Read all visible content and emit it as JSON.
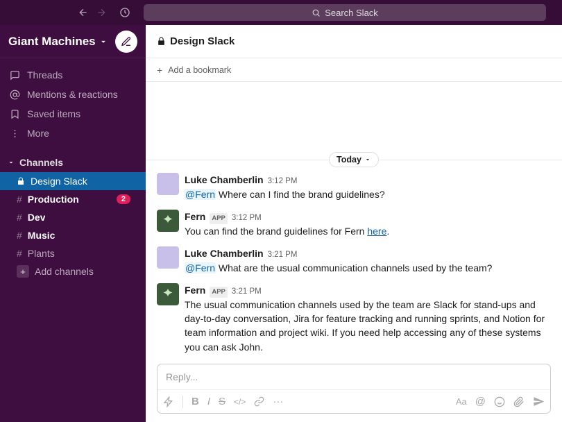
{
  "search": {
    "placeholder": "Search Slack"
  },
  "workspace": {
    "name": "Giant Machines"
  },
  "sidebar": {
    "threads": "Threads",
    "mentions": "Mentions & reactions",
    "saved": "Saved items",
    "more": "More",
    "channels_header": "Channels",
    "add_channels": "Add channels",
    "channels": [
      {
        "label": "Design Slack",
        "prefix": "lock",
        "active": true,
        "badge": null,
        "unread": false
      },
      {
        "label": "Production",
        "prefix": "#",
        "active": false,
        "badge": "2",
        "unread": true
      },
      {
        "label": "Dev",
        "prefix": "#",
        "active": false,
        "badge": null,
        "unread": true
      },
      {
        "label": "Music",
        "prefix": "#",
        "active": false,
        "badge": null,
        "unread": true
      },
      {
        "label": "Plants",
        "prefix": "#",
        "active": false,
        "badge": null,
        "unread": false
      }
    ]
  },
  "channel": {
    "name": "Design Slack",
    "bookmark": "Add a bookmark",
    "date_label": "Today"
  },
  "messages": [
    {
      "author": "Luke Chamberlin",
      "app": false,
      "time": "3:12 PM",
      "avatar": "user",
      "body": {
        "mention": "@Fern",
        "text": " Where can I find the brand guidelines?"
      }
    },
    {
      "author": "Fern",
      "app": true,
      "time": "3:12 PM",
      "avatar": "fern",
      "body": {
        "pre": "You can find the brand guidelines for Fern ",
        "link": "here",
        "post": "."
      }
    },
    {
      "author": "Luke Chamberlin",
      "app": false,
      "time": "3:21 PM",
      "avatar": "user",
      "body": {
        "mention": "@Fern",
        "text": " What are the usual communication channels used by the team?"
      }
    },
    {
      "author": "Fern",
      "app": true,
      "time": "3:21 PM",
      "avatar": "fern",
      "body": {
        "text": "The usual communication channels used by the team are Slack for stand-ups and day-to-day conversation, Jira for feature tracking and running sprints, and Notion for team information and project wiki. If you need help accessing any of these systems you can ask John."
      }
    }
  ],
  "composer": {
    "placeholder": "Reply...",
    "app_label": "APP"
  }
}
